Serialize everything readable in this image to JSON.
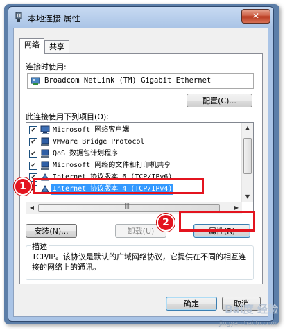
{
  "window": {
    "title": "本地连接 属性",
    "close_label": "✕"
  },
  "tabs": [
    {
      "label": "网络",
      "active": true
    },
    {
      "label": "共享",
      "active": false
    }
  ],
  "connect_using": {
    "label": "连接时使用:",
    "adapter": "Broadcom NetLink (TM) Gigabit Ethernet",
    "configure_button": "配置(C)..."
  },
  "items_section": {
    "label": "此连接使用下列项目(O):",
    "items": [
      {
        "label": "Microsoft 网络客户端",
        "checked": true,
        "icon": "network-client-icon"
      },
      {
        "label": "VMware Bridge Protocol",
        "checked": true,
        "icon": "network-protocol-icon"
      },
      {
        "label": "QoS 数据包计划程序",
        "checked": true,
        "icon": "network-service-icon"
      },
      {
        "label": "Microsoft 网络的文件和打印机共享",
        "checked": true,
        "icon": "network-service-icon"
      },
      {
        "label": "Internet 协议版本 6 (TCP/IPv6)",
        "checked": true,
        "icon": "network-protocol-icon"
      },
      {
        "label": "Internet 协议版本 4 (TCP/IPv4)",
        "checked": true,
        "icon": "network-protocol-icon",
        "selected": true
      }
    ]
  },
  "buttons": {
    "install": "安装(N)...",
    "uninstall": "卸载(U)",
    "properties": "属性(R)"
  },
  "description": {
    "title": "描述",
    "text": "TCP/IP。该协议是默认的广域网络协议，它提供在不同的相互连接的网络上的通讯。"
  },
  "footer": {
    "ok": "确定",
    "cancel": "取消"
  },
  "annotations": {
    "badge_1": "1",
    "badge_2": "2",
    "color": "#e3141f"
  },
  "watermark": {
    "brand": "Bai度 经验",
    "url": "jingyan.baidu.com"
  }
}
